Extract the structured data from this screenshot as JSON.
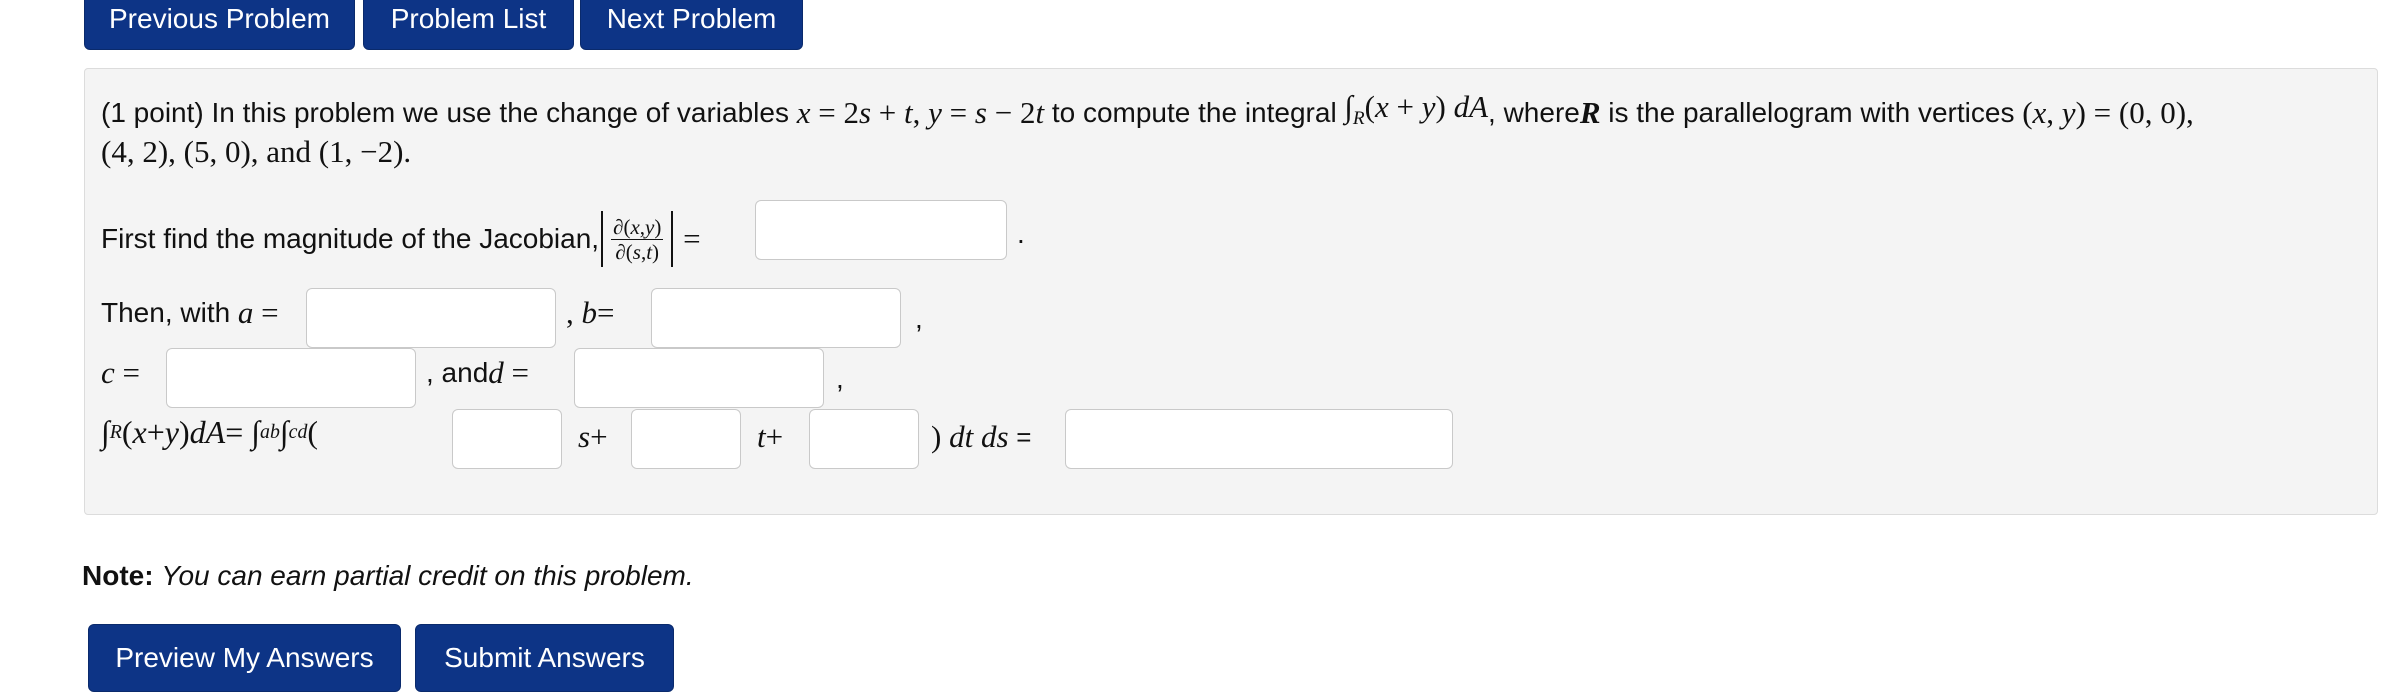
{
  "nav": {
    "previous_label": "Previous Problem",
    "list_label": "Problem List",
    "next_label": "Next Problem"
  },
  "problem": {
    "intro_text_1": "(1 point) In this problem we use the change of variables ",
    "intro_text_2": " to compute the integral ",
    "intro_text_3": ", where ",
    "intro_text_4": " is the parallelogram with vertices ",
    "vertices_line2": "(4, 2), (5, 0), and (1, −2).",
    "jacobian_prompt": "First find the magnitude of the Jacobian, ",
    "then_with": "Then, with ",
    "and_text": ", and "
  },
  "answers": {
    "jacobian": "",
    "a": "",
    "b": "",
    "c": "",
    "d": "",
    "s_coef": "",
    "t_coef": "",
    "const": "",
    "result": ""
  },
  "note": {
    "label": "Note:",
    "text": "You can earn partial credit on this problem."
  },
  "actions": {
    "preview_label": "Preview My Answers",
    "submit_label": "Submit Answers"
  },
  "colors": {
    "button_bg": "#0d3486",
    "panel_bg": "#f4f4f4"
  }
}
